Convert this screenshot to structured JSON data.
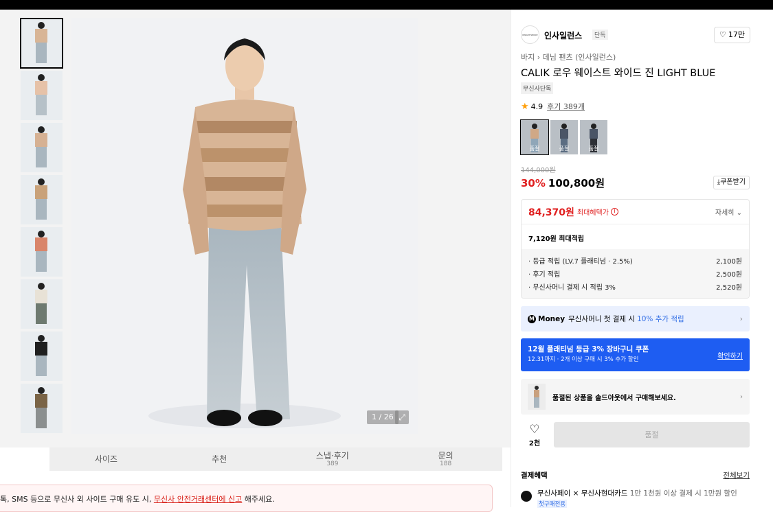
{
  "gallery": {
    "counter": "1 / 26",
    "expand_icon": "expand-icon",
    "thumbnails": [
      "look-1",
      "look-2",
      "look-3",
      "look-4",
      "look-5",
      "look-6",
      "look-7",
      "look-8"
    ]
  },
  "tabs": [
    {
      "label": "사이즈",
      "count": ""
    },
    {
      "label": "추천",
      "count": ""
    },
    {
      "label": "스냅·후기",
      "count": "389"
    },
    {
      "label": "문의",
      "count": "188"
    }
  ],
  "notice": {
    "before": "톡, SMS 등으로 무신사 외 사이트 구매 유도 시, ",
    "link": "무신사 안전거래센터에 신고",
    "after": " 해주세요."
  },
  "product": {
    "brand_logo_text": "INSIGHTLENCE",
    "brand_name": "인사일런스",
    "brand_badge": "단독",
    "likes": "17만",
    "breadcrumb_1": "바지",
    "breadcrumb_2": "데님 팬츠 (인사일런스)",
    "title": "CALIK 로우 웨이스트 와이드 진 LIGHT BLUE",
    "tag": "무신사단독",
    "rating": "4.9",
    "reviews": "후기 389개",
    "colors": [
      {
        "label": "품절",
        "tone": "#8fa6b8"
      },
      {
        "label": "품절",
        "tone": "#5b6d82"
      },
      {
        "label": "품절",
        "tone": "#2c2f35"
      }
    ],
    "original_price": "144,000원",
    "discount": "30%",
    "price": "100,800원",
    "coupon_label": "쿠폰받기"
  },
  "benefits": {
    "best_price": "84,370원",
    "best_label": "최대혜택가",
    "more_label": "자세히",
    "points_total": "7,120원 최대적립",
    "points": [
      {
        "label": "· 등급 적립 (LV.7 플래티넘 · 2.5%)",
        "value": "2,100원"
      },
      {
        "label": "· 후기 적립",
        "value": "2,500원"
      },
      {
        "label": "· 무신사머니 결제 시 적립 3%",
        "value": "2,520원"
      }
    ]
  },
  "money": {
    "logo": "M",
    "name": "Money",
    "text": "무신사머니 첫 결제 시",
    "highlight": "10% 추가 적립"
  },
  "promo": {
    "title": "12월 플래티넘 등급 3% 장바구니 쿠폰",
    "subtitle": "12.31까지 · 2개 이상 구매 시 3% 추가 할인",
    "cta": "확인하기"
  },
  "soldout": {
    "text": "품절된 상품을 솔드아웃에서 구매해보세요."
  },
  "actions": {
    "wish_count": "2천",
    "buy_label": "품절"
  },
  "payment": {
    "heading": "결제혜택",
    "see_all": "전체보기",
    "line1_a": "무신사페이 × 무신사현대카드",
    "line1_b": " 1만 1천원 이상 결제 시 1만원 할인",
    "line1_tag": "첫구매전용"
  },
  "colors_theme": {
    "accent_red": "#e02020",
    "accent_blue": "#1e5df2",
    "star": "#ff9f0a"
  }
}
